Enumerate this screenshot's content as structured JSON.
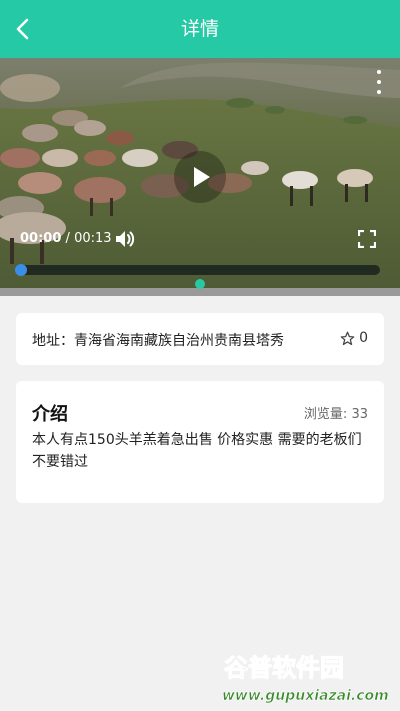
{
  "header": {
    "title": "详情",
    "back_icon": "chevron-left-icon"
  },
  "video": {
    "current_time": "00:00",
    "separator": "/",
    "duration": "00:13",
    "progress": 0,
    "icons": {
      "more": "more-vertical-icon",
      "play": "play-icon",
      "volume": "volume-icon",
      "fullscreen": "fullscreen-icon"
    }
  },
  "address": {
    "label": "地址：",
    "value": "青海省海南藏族自治州贵南县塔秀",
    "favorite_count": "0",
    "favorite_icon": "star-outline-icon"
  },
  "intro": {
    "title": "介绍",
    "views_label": "浏览量:",
    "views_count": "33",
    "description": "本人有点150头羊羔着急出售 价格实惠 需要的老板们不要错过"
  },
  "watermark": {
    "line1": "谷普软件园",
    "line2": "www.gupuxiazai.com"
  },
  "colors": {
    "accent": "#26c9a6",
    "progress_knob": "#3a8ee6"
  }
}
